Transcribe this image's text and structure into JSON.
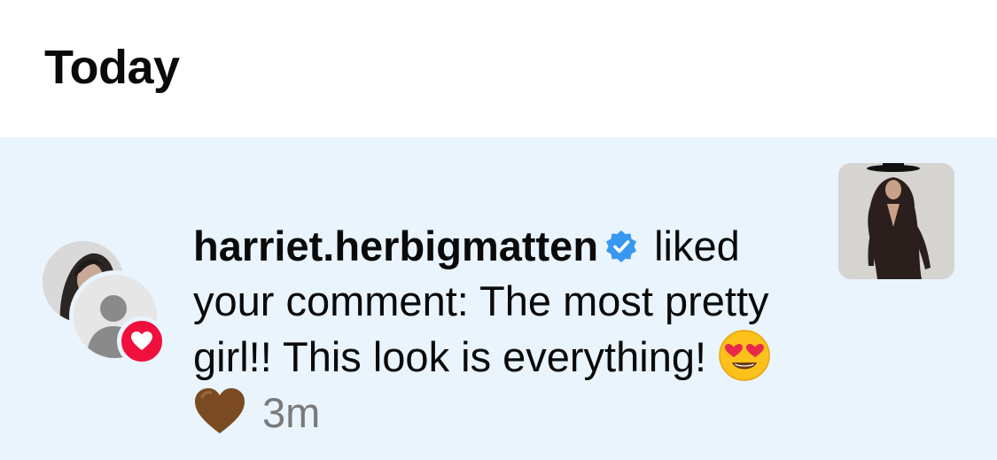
{
  "section": {
    "title": "Today"
  },
  "notification": {
    "username": "harriet.herbigmatten",
    "verified": true,
    "action_text": " liked your comment: The most pretty girl!! This look is everything! ",
    "emojis": [
      "heart-eyes-emoji",
      "brown-heart-emoji"
    ],
    "timestamp": "3m",
    "badge_icon": "heart-icon",
    "colors": {
      "row_background": "#e9f4fd",
      "badge": "#f0103e",
      "verified": "#3897f0",
      "timestamp": "#7a7a7a"
    }
  }
}
